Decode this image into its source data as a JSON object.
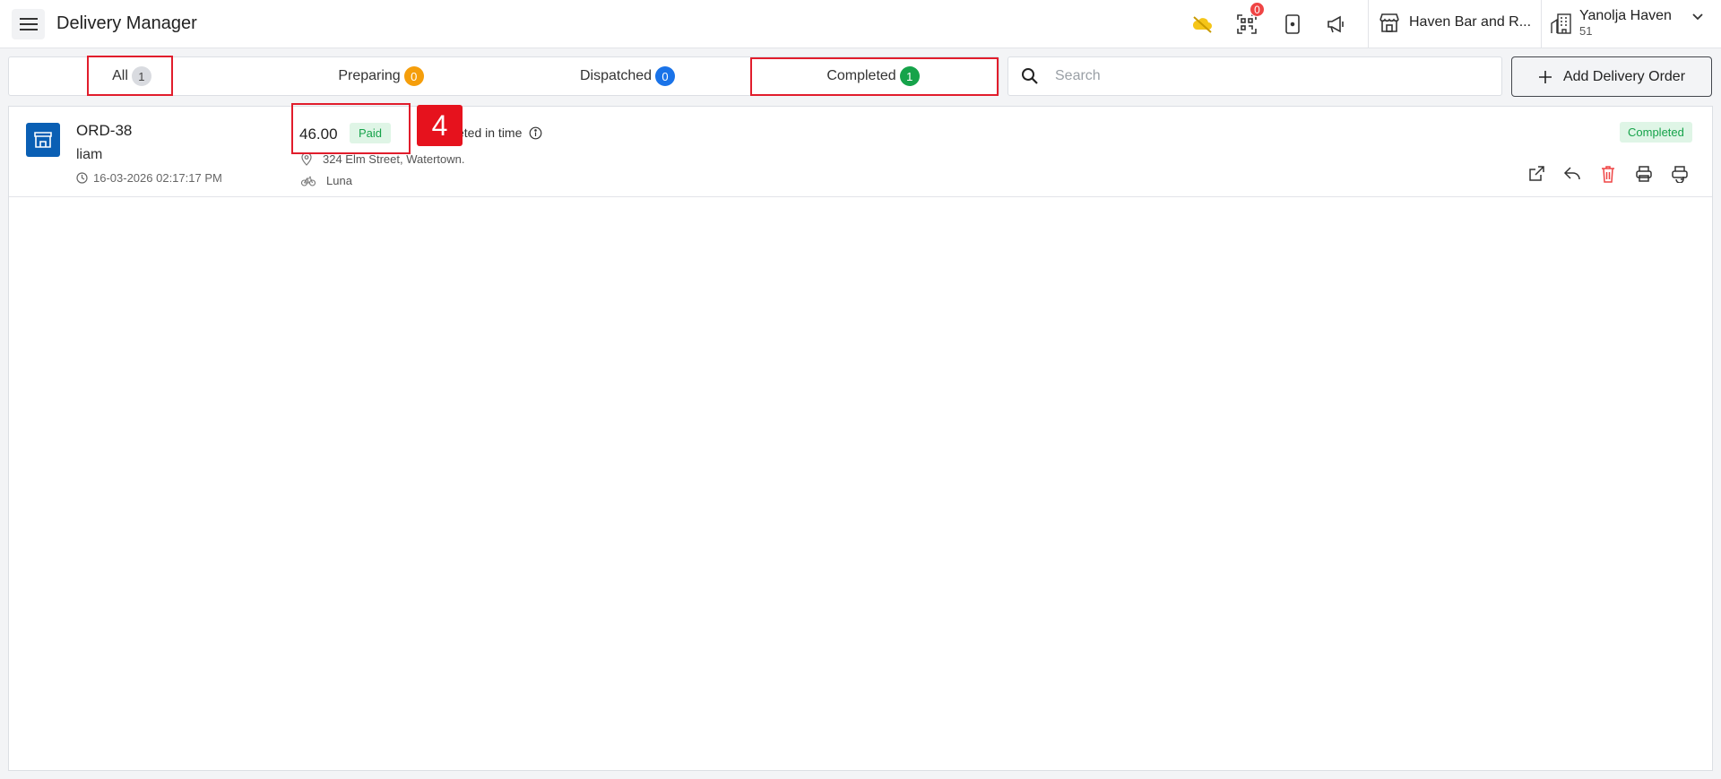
{
  "header": {
    "title": "Delivery Manager",
    "qr_badge_count": "0",
    "restaurant_name": "Haven Bar and R...",
    "property_name": "Yanolja Haven",
    "property_number": "51"
  },
  "tabs": [
    {
      "label": "All",
      "count": "1"
    },
    {
      "label": "Preparing",
      "count": "0"
    },
    {
      "label": "Dispatched",
      "count": "0"
    },
    {
      "label": "Completed",
      "count": "1"
    }
  ],
  "search": {
    "placeholder": "Search"
  },
  "add_button": {
    "label": "Add Delivery Order"
  },
  "annotation": {
    "number": "4"
  },
  "orders": [
    {
      "id": "ORD-38",
      "customer": "liam",
      "timestamp": "16-03-2026 02:17:17 PM",
      "amount": "46.00",
      "payment_status": "Paid",
      "timing": "Completed in time",
      "timing_visible": "eted in time",
      "address": "324 Elm Street, Watertown.",
      "driver": "Luna",
      "status": "Completed"
    }
  ],
  "colors": {
    "accent_blue": "#0a5fb4",
    "highlight_red": "#e11d2c",
    "success_green": "#16a34a",
    "warning_orange": "#f59e0b",
    "info_blue": "#1a73e8",
    "danger_red": "#ef4444"
  }
}
